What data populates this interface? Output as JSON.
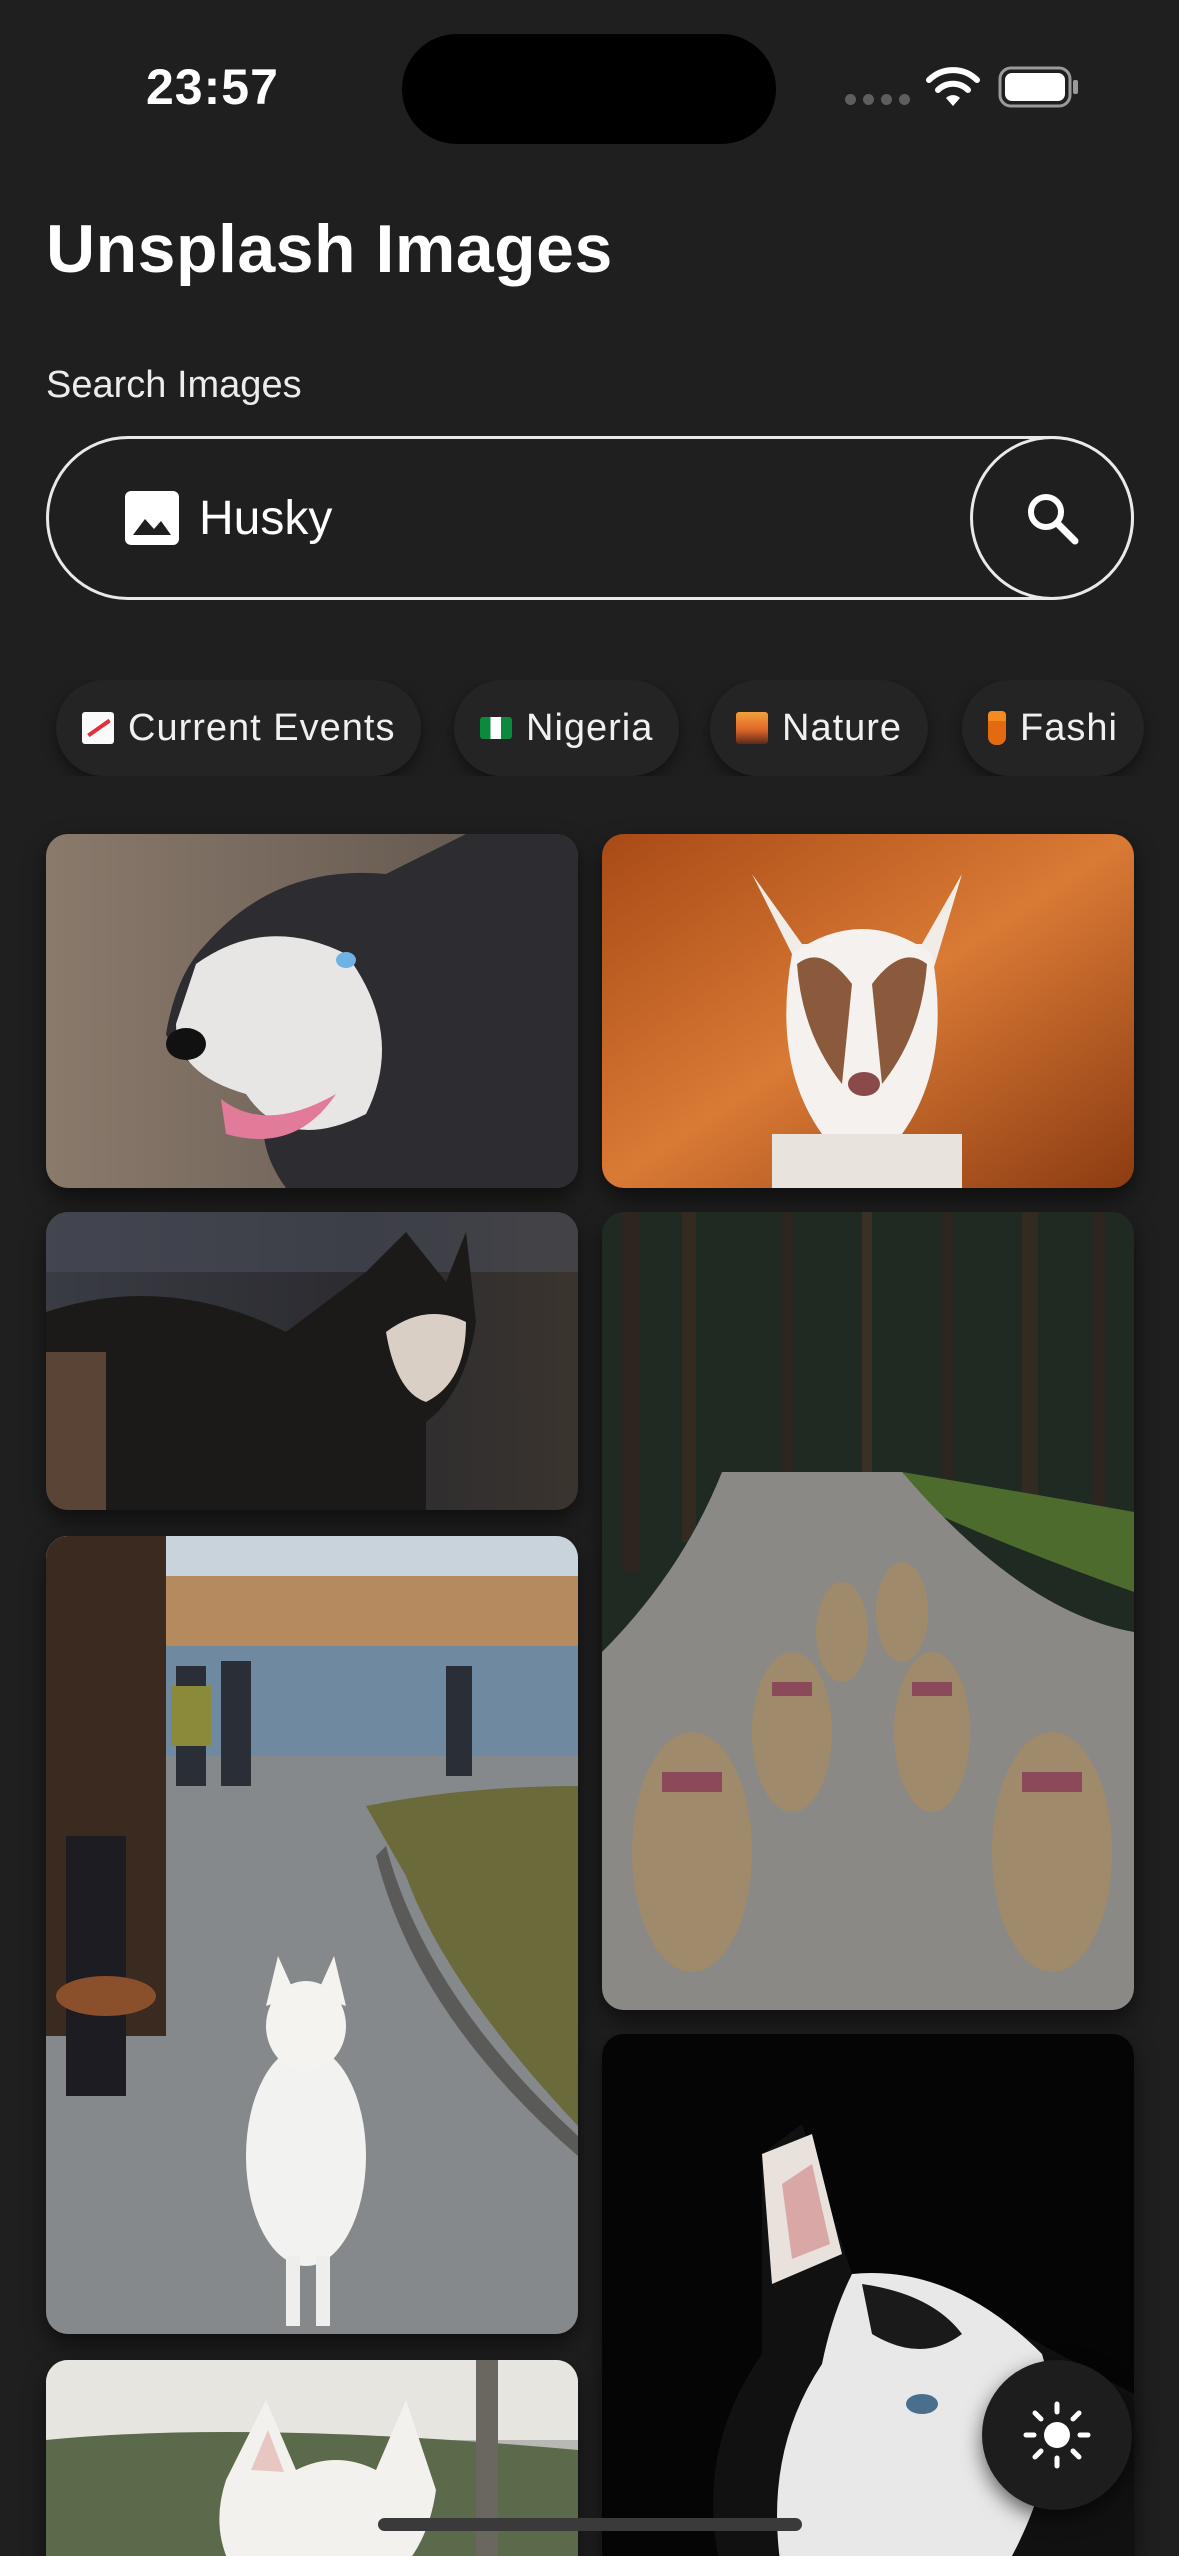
{
  "status_bar": {
    "time": "23:57"
  },
  "header": {
    "title": "Unsplash Images"
  },
  "search": {
    "label": "Search Images",
    "value": "Husky",
    "placeholder": ""
  },
  "categories": [
    {
      "label": "Current Events",
      "icon": "chart-increasing-emoji"
    },
    {
      "label": "Nigeria",
      "icon": "nigeria-flag-emoji"
    },
    {
      "label": "Nature",
      "icon": "sunset-emoji"
    },
    {
      "label": "Fashi",
      "icon": "dress-emoji"
    }
  ],
  "photos": [
    {
      "subject": "husky-closeup-tongue"
    },
    {
      "subject": "husky-puppy-orange-background"
    },
    {
      "subject": "husky-with-harness"
    },
    {
      "subject": "sled-dog-team-forest-path"
    },
    {
      "subject": "white-dog-walking-park"
    },
    {
      "subject": "husky-black-background"
    },
    {
      "subject": "white-husky-outdoors"
    }
  ],
  "colors": {
    "background": "#1f1f1f",
    "text": "#ffffff",
    "outline": "#e9e9e9"
  }
}
